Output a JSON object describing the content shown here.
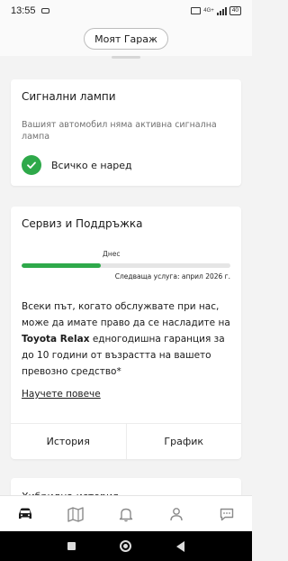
{
  "status_bar": {
    "time": "13:55",
    "network": "4G+",
    "battery": "40"
  },
  "header": {
    "garage_button": "Моят Гараж"
  },
  "warning_card": {
    "title": "Сигнални лампи",
    "message": "Вашият автомобил няма активна сигнална лампа",
    "status": "Всичко е наред",
    "status_color": "#2ea94a"
  },
  "service_card": {
    "title": "Сервиз и Поддръжка",
    "today_label": "Днес",
    "progress_fraction": 0.38,
    "next_service": "Следваща услуга: април 2026 г.",
    "description_pre": "Всеки път, когато обслужвате при нас, може да имате право да се насладите на",
    "description_brand": "Toyota Relax",
    "description_post": "едногодишна гаранция за до 10 години от възрастта на вашето превозно средство*",
    "learn_more": "Научете повече",
    "history_button": "История",
    "schedule_button": "График"
  },
  "next_card": {
    "title": "Хибридна история"
  },
  "bottom_nav": {
    "items": [
      "car-icon",
      "map-icon",
      "bell-icon",
      "profile-icon",
      "chat-icon"
    ],
    "active_color": "#1b1b1b",
    "inactive_color": "#8a8a8a"
  }
}
